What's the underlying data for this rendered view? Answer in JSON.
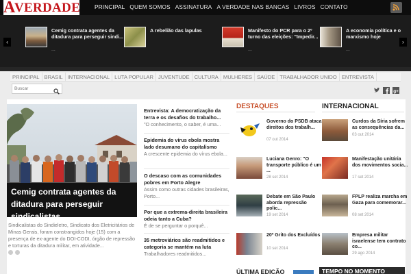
{
  "brand": {
    "logo_initial": "A",
    "logo_rest": "VERDADE",
    "accent": "#c4161c"
  },
  "topnav": [
    "PRINCIPAL",
    "QUEM SOMOS",
    "ASSINATURA",
    "A VERDADE NAS BANCAS",
    "LIVROS",
    "CONTATO"
  ],
  "carousel": {
    "items": [
      {
        "title": "Cemig contrata agentes da ditadura para perseguir sindi...",
        "more": "..."
      },
      {
        "title": "A rebelião das lapulas",
        "more": ""
      },
      {
        "title": "Manifesto do PCR para o 2º turno das eleições: \"Impedir...",
        "more": "..."
      },
      {
        "title": "A economia política e o marxismo hoje",
        "more": "..."
      }
    ],
    "prev": "‹",
    "next": "›"
  },
  "secnav": [
    "PRINCIPAL",
    "BRASIL",
    "INTERNACIONAL",
    "LUTA POPULAR",
    "JUVENTUDE",
    "CULTURA",
    "MULHERES",
    "SAÚDE",
    "TRABALHADOR UNIDO",
    "ENTREVISTA"
  ],
  "search": {
    "placeholder": "Buscar"
  },
  "featured": {
    "title": "Cemig contrata agentes da ditadura para perseguir sindicalistas",
    "excerpt": "Sindicalistas do Sindieletro, Sindicato dos Eletricitários de Minas Gerais, foram constrangidos hoje (15) com a presença de ex-agente do DOI-CODI, órgão de repressão e torturas da ditadura militar, em atividade..."
  },
  "middle": [
    {
      "title": "Entrevista: A democratização da terra e os desafios do trabalho...",
      "excerpt": "\"O conhecimento, o saber, é uma..."
    },
    {
      "title": "Epidemia do vírus ebola mostra lado desumano do capitalismo",
      "excerpt": "A crescente epidemia do vírus ebola..."
    },
    {
      "title": "O descaso com as comunidades pobres em Porto Alegre",
      "excerpt": "Assim como outras cidades brasileiras, Porto..."
    },
    {
      "title": "Por que a extrema-direita brasileira odeia tanto a Cuba?",
      "excerpt": "É de se perguntar o porquê..."
    },
    {
      "title": "35 metroviários são readmitidos e categoria se mantém na luta",
      "excerpt": "Trabalhadores readmitidos..."
    }
  ],
  "destaques": {
    "header": "DESTAQUES",
    "color": "#c8502a",
    "items": [
      {
        "title": "Governo do PSDB ataca direitos dos trabalh...",
        "date": "07 out 2014"
      },
      {
        "title": "Luciana Genro: \"O transporte público é um ...",
        "date": "28 set 2014"
      },
      {
        "title": "Debate em São Paulo aborda repressão polic...",
        "date": "19 set 2014"
      },
      {
        "title": "20º Grito dos Excluídos",
        "date": "10 set 2014"
      }
    ]
  },
  "internacional": {
    "header": "INTERNACIONAL",
    "items": [
      {
        "title": "Curdos da Síria sofrem as consequências da...",
        "date": "03 out 2014"
      },
      {
        "title": "Manifestação unitária dos movimentos socia...",
        "date": "17 set 2014"
      },
      {
        "title": "FPLP realiza marcha em Gaza para comemorar...",
        "date": "08 set 2014"
      },
      {
        "title": "Empresa militar israelense tem contrato co...",
        "date": "29 ago 2014"
      }
    ]
  },
  "bottom": {
    "edicao": "ÚLTIMA EDIÇÃO",
    "tempo": "TEMPO NO MOMENTO"
  }
}
